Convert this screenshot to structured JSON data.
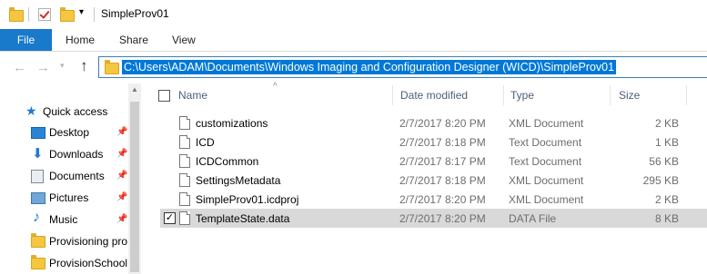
{
  "window": {
    "title": "SimpleProv01"
  },
  "ribbon": {
    "file": "File",
    "tabs": [
      "Home",
      "Share",
      "View"
    ]
  },
  "address": {
    "path": "C:\\Users\\ADAM\\Documents\\Windows Imaging and Configuration Designer (WICD)\\SimpleProv01"
  },
  "nav": {
    "quick_access": "Quick access",
    "items": [
      {
        "label": "Desktop",
        "icon": "desktop-icon",
        "pinned": true
      },
      {
        "label": "Downloads",
        "icon": "download-icon",
        "pinned": true
      },
      {
        "label": "Documents",
        "icon": "documents-icon",
        "pinned": true
      },
      {
        "label": "Pictures",
        "icon": "pictures-icon",
        "pinned": true
      },
      {
        "label": "Music",
        "icon": "music-icon",
        "pinned": true
      },
      {
        "label": "Provisioning pro",
        "icon": "folder-icon",
        "pinned": false
      },
      {
        "label": "ProvisionSchool",
        "icon": "folder-icon",
        "pinned": false
      }
    ]
  },
  "columns": {
    "name": "Name",
    "date": "Date modified",
    "type": "Type",
    "size": "Size"
  },
  "files": [
    {
      "name": "customizations",
      "date": "2/7/2017 8:20 PM",
      "type": "XML Document",
      "size": "2 KB",
      "selected": false
    },
    {
      "name": "ICD",
      "date": "2/7/2017 8:18 PM",
      "type": "Text Document",
      "size": "1 KB",
      "selected": false
    },
    {
      "name": "ICDCommon",
      "date": "2/7/2017 8:17 PM",
      "type": "Text Document",
      "size": "56 KB",
      "selected": false
    },
    {
      "name": "SettingsMetadata",
      "date": "2/7/2017 8:18 PM",
      "type": "XML Document",
      "size": "295 KB",
      "selected": false
    },
    {
      "name": "SimpleProv01.icdproj",
      "date": "2/7/2017 8:20 PM",
      "type": "XML Document",
      "size": "2 KB",
      "selected": false
    },
    {
      "name": "TemplateState.data",
      "date": "2/7/2017 8:20 PM",
      "type": "DATA File",
      "size": "8 KB",
      "selected": true
    }
  ],
  "colors": {
    "accent": "#1979ca",
    "selection": "#0078d7",
    "row_selected": "#d9d9d9",
    "folder": "#f5c640"
  }
}
